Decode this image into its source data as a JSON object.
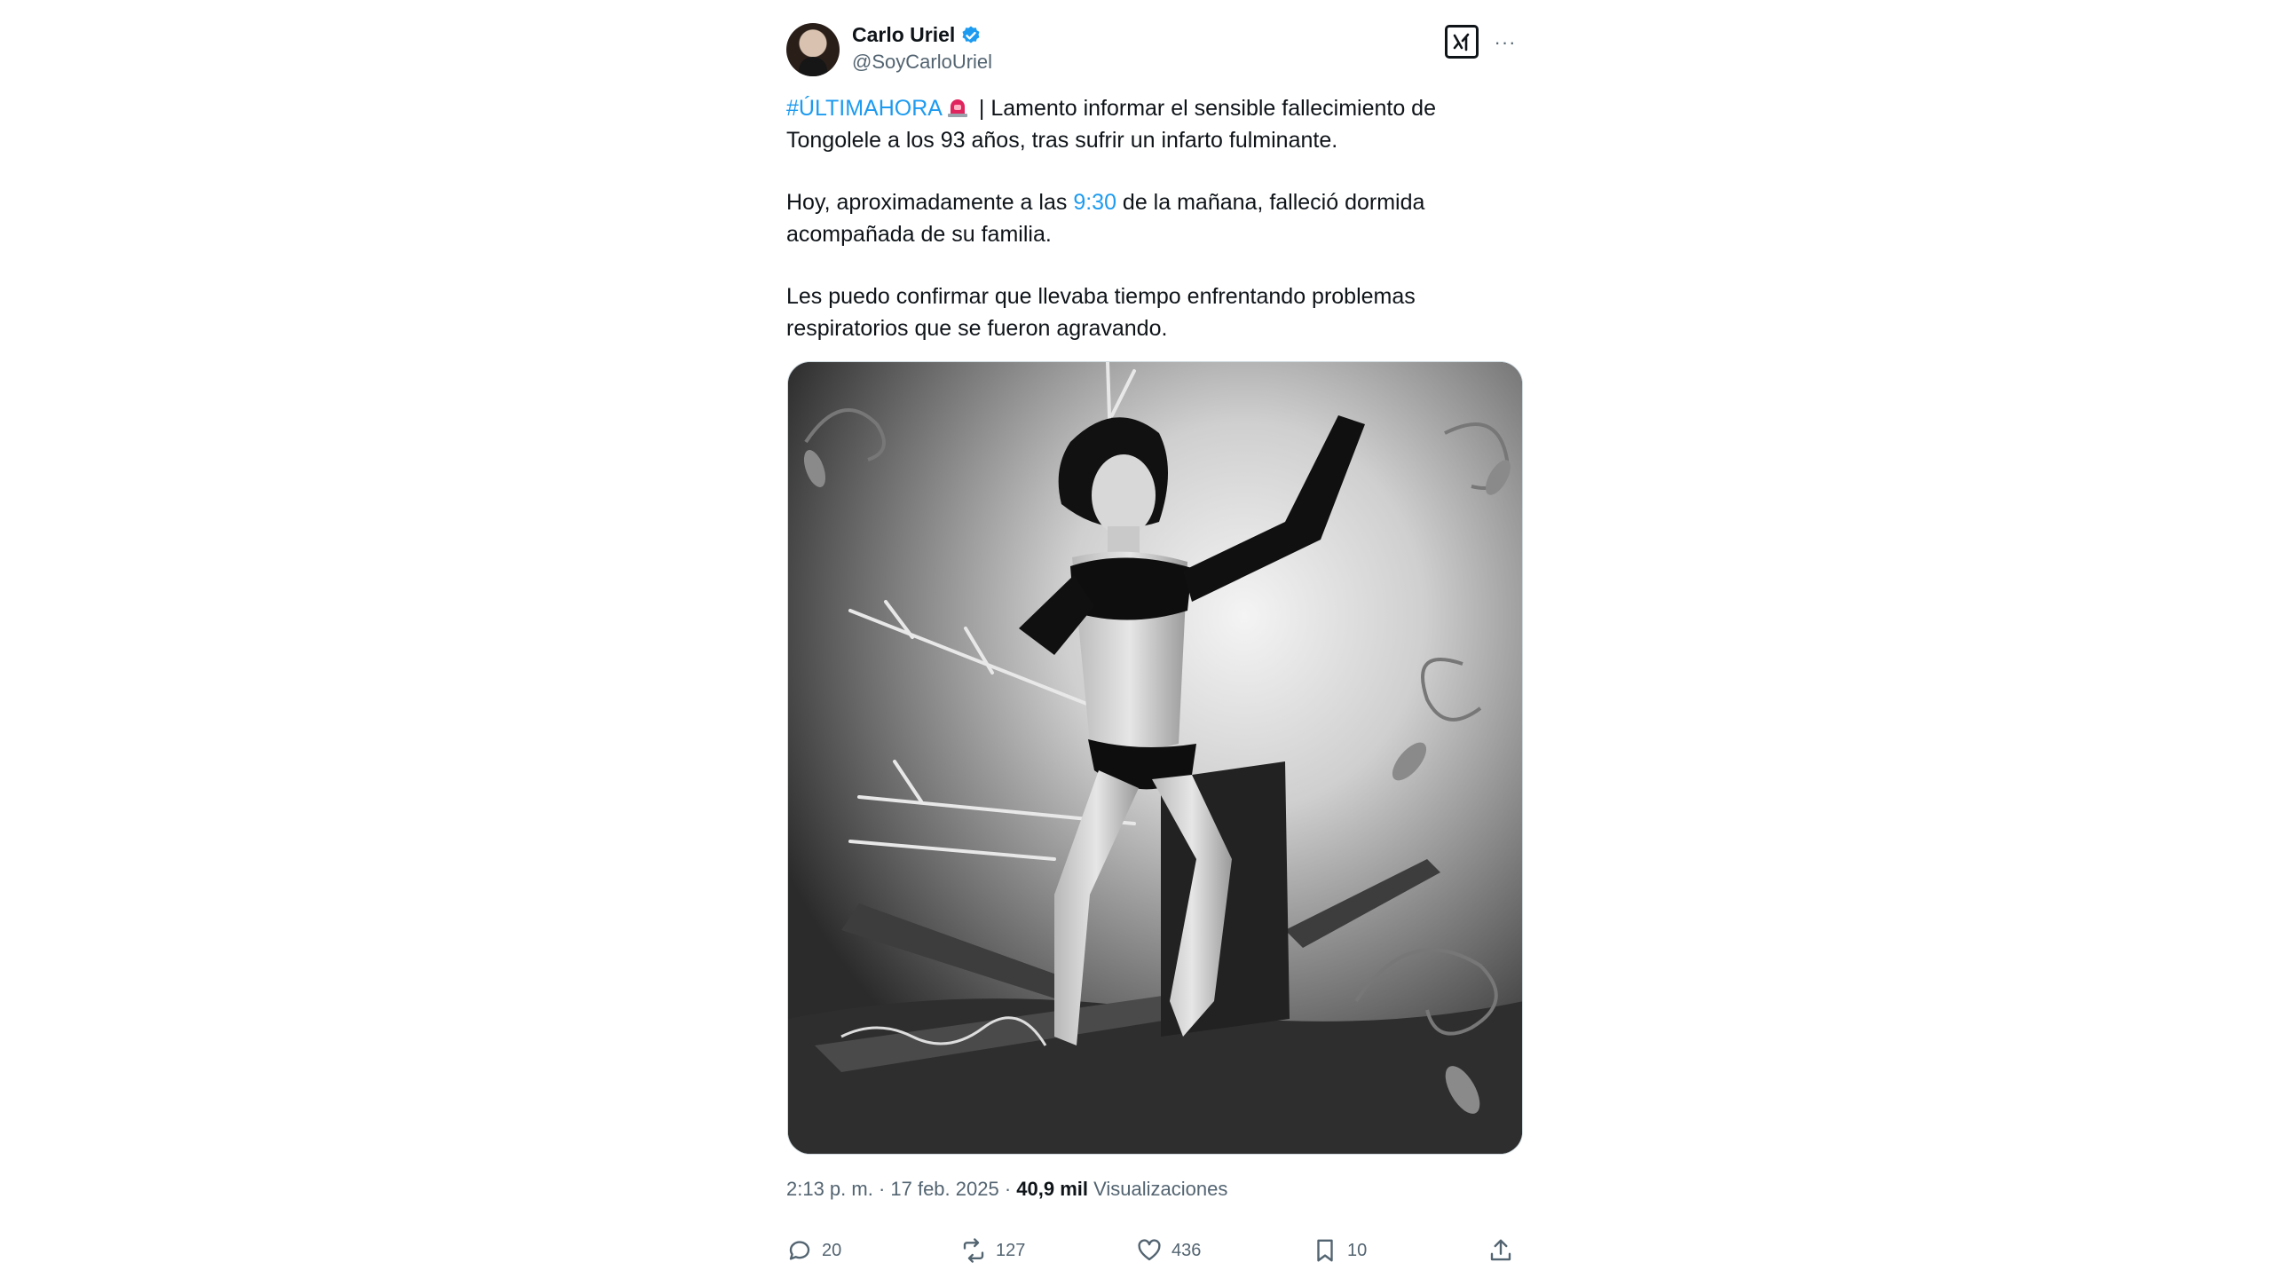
{
  "author": {
    "display_name": "Carlo Uriel",
    "handle": "@SoyCarloUriel",
    "verified": true,
    "avatar_icon": "avatar"
  },
  "header_buttons": {
    "grok_icon": "grok-icon",
    "more_icon": "more-icon"
  },
  "tweet": {
    "hashtag": "#ÚLTIMAHORA",
    "para1_rest": " | Lamento informar el sensible fallecimiento de Tongolele a los 93 años, tras sufrir un infarto fulminante.",
    "para2_before": "Hoy, aproximadamente a las ",
    "para2_link": "9:30",
    "para2_after": " de la mañana, falleció dormida acompañada de su familia.",
    "para3": "Les puedo confirmar que llevaba tiempo enfrentando problemas respiratorios que se fueron agravando."
  },
  "media": {
    "description_icon": "photo"
  },
  "meta": {
    "timestamp": "2:13 p. m. · 17 feb. 2025 · ",
    "views_count": "40,9 mil",
    "views_label": " Visualizaciones"
  },
  "actions": {
    "replies": "20",
    "reposts": "127",
    "likes": "436",
    "bookmarks": "10"
  },
  "colors": {
    "link": "#1d9bf0",
    "muted": "#536471",
    "text": "#0f1419"
  }
}
